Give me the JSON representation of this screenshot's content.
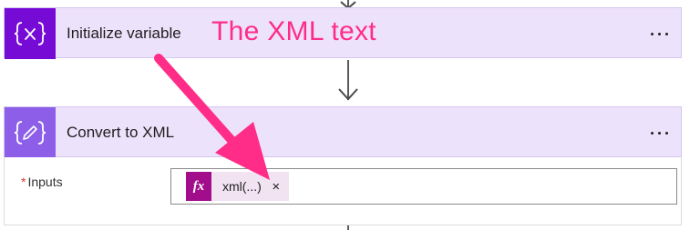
{
  "steps": [
    {
      "icon": "curly-braces-x-icon",
      "icon_text": "{x}",
      "title": "Initialize variable",
      "menu_icon": "ellipsis-icon",
      "header_color": "#ede2fb",
      "icon_color": "#770bd6"
    },
    {
      "icon": "curly-braces-pen-icon",
      "title": "Convert to XML",
      "menu_icon": "ellipsis-icon",
      "header_color": "#ede2fb",
      "icon_color": "#8d5fe8",
      "fields": [
        {
          "label": "Inputs",
          "required_mark": "*",
          "token": {
            "icon": "fx-function-icon",
            "icon_text": "fx",
            "text": "xml(...)",
            "remove": "×",
            "token_color": "#a10d8a"
          }
        }
      ]
    }
  ],
  "annotation": {
    "text": "The XML text",
    "color": "#ff2d87"
  }
}
